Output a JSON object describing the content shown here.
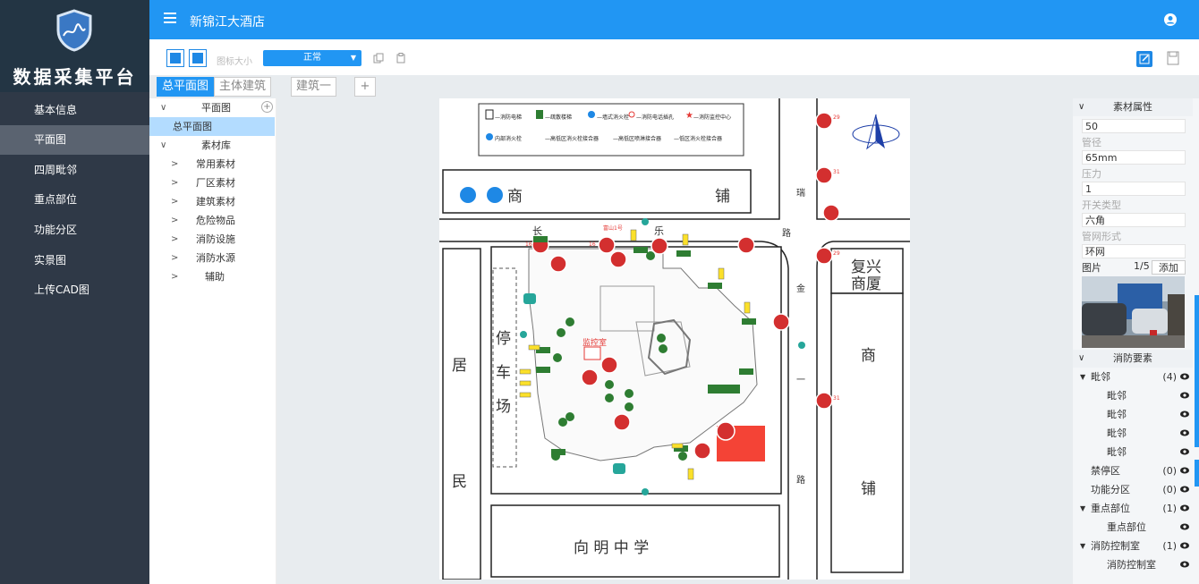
{
  "sidebar": {
    "title": "数据采集平台",
    "items": [
      {
        "label": "基本信息"
      },
      {
        "label": "平面图"
      },
      {
        "label": "四周毗邻"
      },
      {
        "label": "重点部位"
      },
      {
        "label": "功能分区"
      },
      {
        "label": "实景图"
      },
      {
        "label": "上传CAD图"
      }
    ]
  },
  "header": {
    "title": "新锦江大酒店"
  },
  "toolbar": {
    "icon_size_label": "图标大小",
    "size_value": "正常"
  },
  "tabs": [
    {
      "label": "总平面图"
    },
    {
      "label": "主体建筑"
    },
    {
      "label": "建筑一"
    },
    {
      "label": "+"
    }
  ],
  "tree": {
    "root": "平面图",
    "selected": "总平面图",
    "library": "素材库",
    "items": [
      {
        "label": "常用素材"
      },
      {
        "label": "厂区素材"
      },
      {
        "label": "建筑素材"
      },
      {
        "label": "危险物品"
      },
      {
        "label": "消防设施"
      },
      {
        "label": "消防水源"
      },
      {
        "label": "辅助"
      }
    ]
  },
  "map": {
    "legend": [
      {
        "label": "—消防电梯"
      },
      {
        "label": "—疏散楼梯"
      },
      {
        "label": "—墙式消火栓"
      },
      {
        "label": "—消防电话插孔"
      },
      {
        "label": "—消防监控中心"
      },
      {
        "label": "内部消火栓"
      },
      {
        "label": "—高低区消火栓接合器"
      },
      {
        "label": "—高低区喷淋接合器"
      },
      {
        "label": "—低区消火栓接合器"
      }
    ],
    "shop_top_left": "商",
    "shop_top_right": "铺",
    "road_top": [
      "长",
      "乐"
    ],
    "road_right": [
      "瑞",
      "路",
      "金",
      "一",
      "路"
    ],
    "left_block": [
      "居",
      "民"
    ],
    "parking": [
      "停",
      "车",
      "场"
    ],
    "building_right_top": [
      "复兴",
      "商厦"
    ],
    "shop_right": [
      "商",
      "铺"
    ],
    "school": "向 明 中 学",
    "monitor_room": "监控室",
    "entrance_label": "富山1号",
    "hydrant_numbers": [
      "29",
      "31",
      "29",
      "31",
      "16",
      "16"
    ]
  },
  "props": {
    "header": "素材属性",
    "fields": [
      {
        "label": "",
        "value": "50"
      },
      {
        "label": "管径",
        "value": "65mm"
      },
      {
        "label": "压力",
        "value": "1"
      },
      {
        "label": "开关类型",
        "value": "六角"
      },
      {
        "label": "管网形式",
        "value": "环网"
      }
    ],
    "image_label": "图片",
    "image_page": "1/5",
    "add_label": "添加"
  },
  "elements": {
    "header": "消防要素",
    "rows": [
      {
        "label": "毗邻",
        "count": "(4)",
        "level": 0,
        "expanded": true
      },
      {
        "label": "毗邻",
        "count": "",
        "level": 1
      },
      {
        "label": "毗邻",
        "count": "",
        "level": 1
      },
      {
        "label": "毗邻",
        "count": "",
        "level": 1
      },
      {
        "label": "毗邻",
        "count": "",
        "level": 1
      },
      {
        "label": "禁停区",
        "count": "(0)",
        "level": 0
      },
      {
        "label": "功能分区",
        "count": "(0)",
        "level": 0
      },
      {
        "label": "重点部位",
        "count": "(1)",
        "level": 0,
        "expanded": true
      },
      {
        "label": "重点部位",
        "count": "",
        "level": 1
      },
      {
        "label": "消防控制室",
        "count": "(1)",
        "level": 0,
        "expanded": true
      },
      {
        "label": "消防控制室",
        "count": "",
        "level": 1
      }
    ]
  },
  "colors": {
    "primary": "#2196f3",
    "sidebar": "#2f3947",
    "hydrant": "#d32f2f",
    "exit": "#2e7d32"
  }
}
